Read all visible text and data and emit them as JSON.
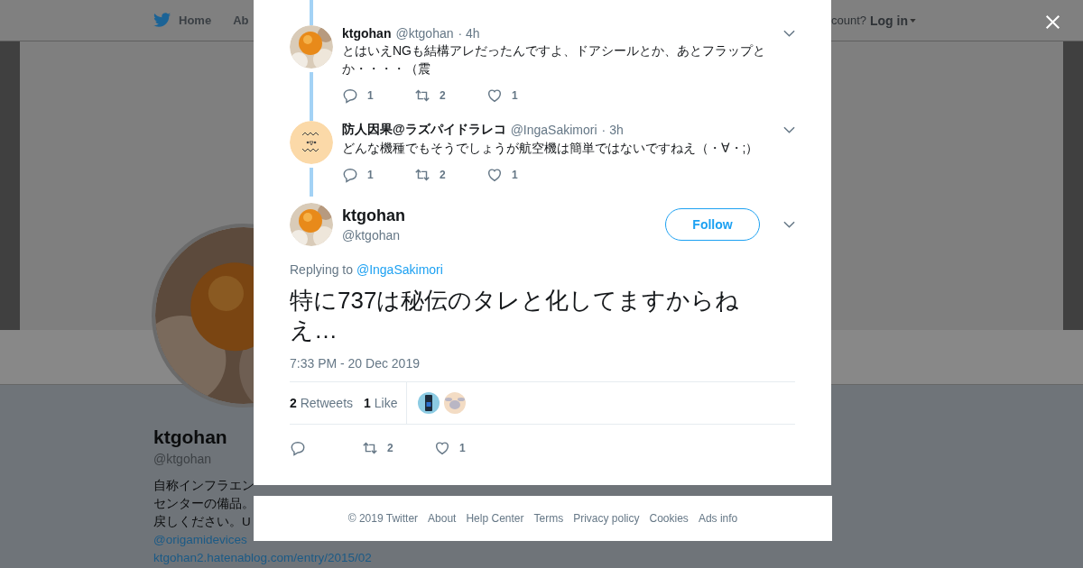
{
  "page": {
    "nav": [
      {
        "label": "Home"
      },
      {
        "label": "Ab"
      }
    ],
    "login_prompt": "count?",
    "login": "Log in",
    "profile": {
      "name": "ktgohan",
      "handle": "@ktgohan",
      "bio": [
        {
          "text": "自称インフラエン",
          "kind": "plain"
        },
        {
          "text": "センターの備品。",
          "kind": "plain"
        },
        {
          "text": "戻しください。U",
          "kind": "plain"
        },
        {
          "text": "@origamidevices",
          "kind": "link"
        },
        {
          "text": "ktgohan2.hatenablog.com/entry/2015/02",
          "kind": "link"
        }
      ]
    }
  },
  "thread": [
    {
      "name": "ktgohan",
      "handle": "@ktgohan",
      "time": "· 4h",
      "text": "とはいえNGも結構アレだったんですよ、ドアシールとか、あとフラップとか・・・・（震",
      "replies": "1",
      "retweets": "2",
      "likes": "1"
    },
    {
      "name": "防人因果@ラズパイドラレコ",
      "handle": "@IngaSakimori",
      "time": "· 3h",
      "text": "どんな機種でもそうでしょうが航空機は簡単ではないですねえ（・∀・;）",
      "replies": "1",
      "retweets": "2",
      "likes": "1"
    }
  ],
  "main_tweet": {
    "name": "ktgohan",
    "handle": "@ktgohan",
    "follow": "Follow",
    "replying_label": "Replying to",
    "replying_to": "@IngaSakimori",
    "text": "特に737は秘伝のタレと化してますからねえ…",
    "timestamp": "7:33 PM - 20 Dec 2019",
    "retweet_count": "2",
    "retweet_label": "Retweets",
    "like_count": "1",
    "like_label": "Like",
    "retweets": "2",
    "likes": "1"
  },
  "footer": [
    "© 2019 Twitter",
    "About",
    "Help Center",
    "Terms",
    "Privacy policy",
    "Cookies",
    "Ads info"
  ]
}
